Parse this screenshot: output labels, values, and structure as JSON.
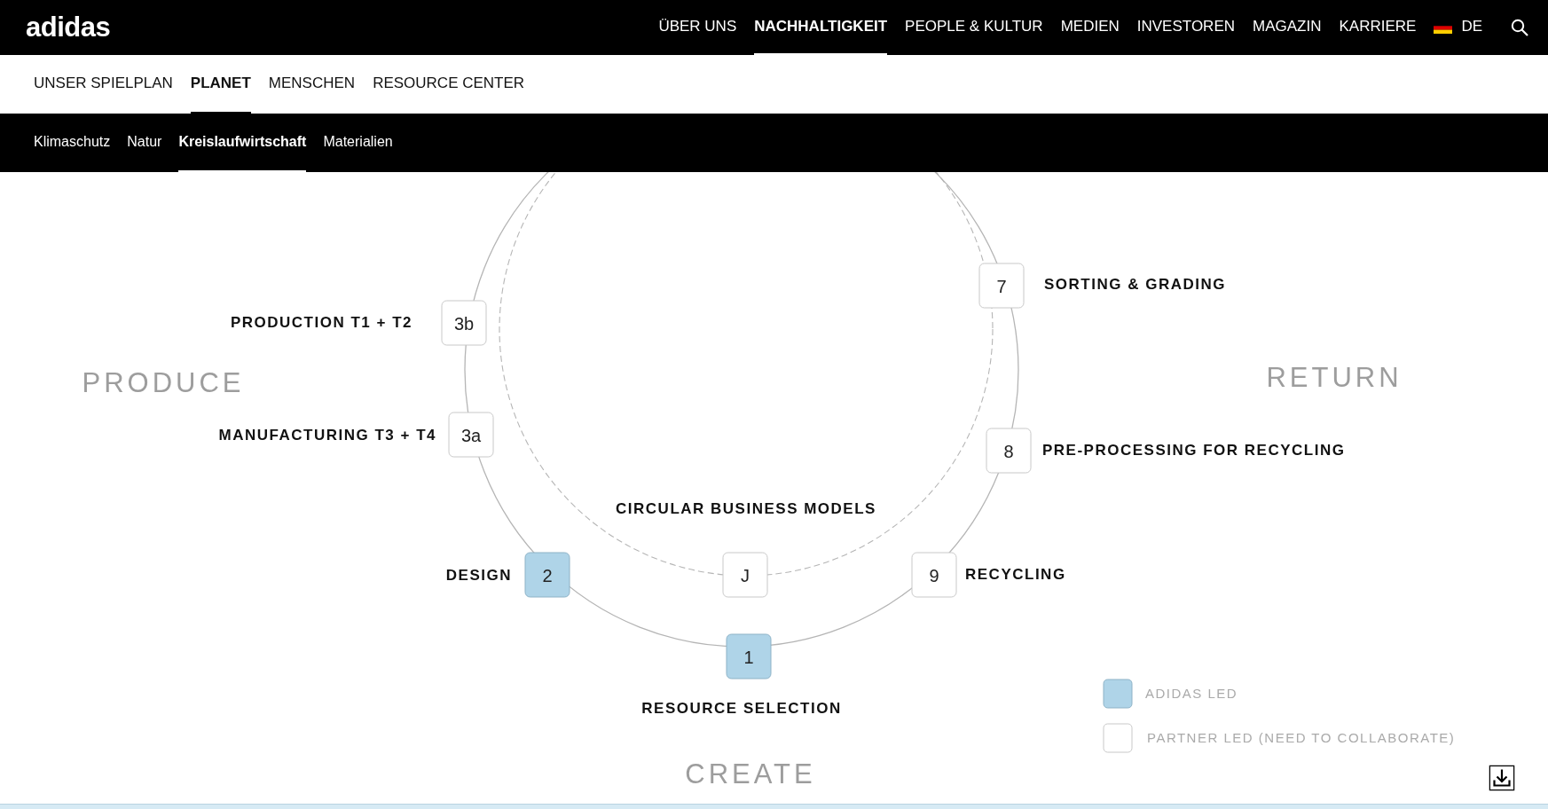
{
  "header": {
    "logo": "adidas",
    "nav": [
      {
        "label": "ÜBER UNS",
        "selected": false
      },
      {
        "label": "NACHHALTIGKEIT",
        "selected": true
      },
      {
        "label": "PEOPLE & KULTUR",
        "selected": false
      },
      {
        "label": "MEDIEN",
        "selected": false
      },
      {
        "label": "INVESTOREN",
        "selected": false
      },
      {
        "label": "MAGAZIN",
        "selected": false
      },
      {
        "label": "KARRIERE",
        "selected": false
      }
    ],
    "language": "DE"
  },
  "subnav": [
    {
      "label": "UNSER SPIELPLAN",
      "selected": false
    },
    {
      "label": "PLANET",
      "selected": true
    },
    {
      "label": "MENSCHEN",
      "selected": false
    },
    {
      "label": "RESOURCE CENTER",
      "selected": false
    }
  ],
  "section_nav": [
    {
      "label": "Klimaschutz",
      "selected": false
    },
    {
      "label": "Natur",
      "selected": false
    },
    {
      "label": "Kreislaufwirtschaft",
      "selected": true
    },
    {
      "label": "Materialien",
      "selected": false
    }
  ],
  "diagram": {
    "phases": [
      "PRODUCE",
      "RETURN",
      "CREATE"
    ],
    "nodes": [
      {
        "label": "3b",
        "adidas_led": false
      },
      {
        "label": "3a",
        "adidas_led": false
      },
      {
        "label": "7",
        "adidas_led": false
      },
      {
        "label": "8",
        "adidas_led": false
      },
      {
        "label": "2",
        "adidas_led": true
      },
      {
        "label": "J",
        "adidas_led": false
      },
      {
        "label": "9",
        "adidas_led": false
      },
      {
        "label": "1",
        "adidas_led": true
      }
    ],
    "captions": [
      "PRODUCTION T1 + T2",
      "MANUFACTURING T3 + T4",
      "SORTING & GRADING",
      "PRE-PROCESSING FOR RECYCLING",
      "DESIGN",
      "RECYCLING",
      "CIRCULAR BUSINESS MODELS",
      "RESOURCE SELECTION"
    ],
    "legend": [
      {
        "label": "ADIDAS LED",
        "adidas_led": true
      },
      {
        "label": "PARTNER LED (NEED TO COLLABORATE)",
        "adidas_led": false
      }
    ]
  }
}
